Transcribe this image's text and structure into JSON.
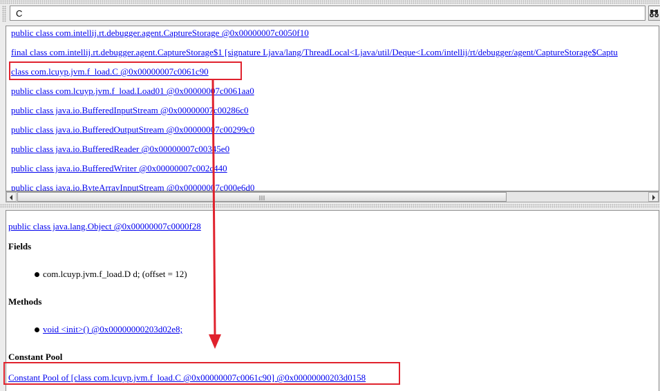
{
  "search": {
    "value": "C"
  },
  "class_list": [
    "public class com.intellij.rt.debugger.agent.CaptureStorage @0x00000007c0050f10",
    "final class com.intellij.rt.debugger.agent.CaptureStorage$1 [signature Ljava/lang/ThreadLocal<Ljava/util/Deque<Lcom/intellij/rt/debugger/agent/CaptureStorage$Captu",
    "class com.lcuyp.jvm.f_load.C @0x00000007c0061c90",
    "public class com.lcuyp.jvm.f_load.Load01 @0x00000007c0061aa0",
    "public class java.io.BufferedInputStream @0x00000007c00286c0",
    "public class java.io.BufferedOutputStream @0x00000007c00299c0",
    "public class java.io.BufferedReader @0x00000007c00345e0",
    "public class java.io.BufferedWriter @0x00000007c002c440",
    "public class java.io.ByteArrayInputStream @0x00000007c000e6d0"
  ],
  "details": {
    "super_class": "public class java.lang.Object @0x00000007c0000f28",
    "fields_heading": "Fields",
    "field_1": "com.lcuyp.jvm.f_load.D d; (offset = 12)",
    "methods_heading": "Methods",
    "method_1": "void <init>() @0x00000000203d02e8;",
    "constant_pool_heading": "Constant Pool",
    "constant_pool_link": "Constant Pool of [class com.lcuyp.jvm.f_load.C @0x00000007c0061c90] @0x00000000203d0158"
  },
  "annotation_color": "#e0222d",
  "link_color": "#0000ee",
  "icons": {
    "find": "binoculars-icon",
    "scroll_left": "scroll-left-arrow",
    "scroll_right": "scroll-right-arrow"
  }
}
